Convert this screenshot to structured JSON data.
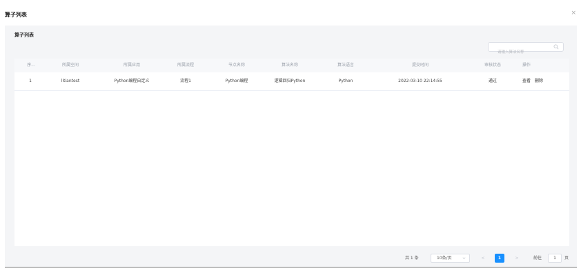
{
  "dialog": {
    "title": "算子列表",
    "close_glyph": "×"
  },
  "panel": {
    "title": "算子列表"
  },
  "search": {
    "placeholder": "请输入算法名称",
    "value": ""
  },
  "table": {
    "columns": [
      "序...",
      "所属空间",
      "所属应用",
      "所属流程",
      "节点名称",
      "算法名称",
      "算法语言",
      "提交时间",
      "审核状态",
      "操作"
    ],
    "rows": [
      {
        "index": "1",
        "space": "litiantest",
        "app": "Python编程自定义",
        "flow": "流程1",
        "node": "Python编程",
        "algo": "逻辑回归Python",
        "lang": "Python",
        "time": "2022-03-10 22:14:55",
        "status": "通过",
        "actions": [
          "查看",
          "删除"
        ]
      }
    ]
  },
  "pagination": {
    "total": "共 1 条",
    "page_size": "10条/页",
    "prev": "<",
    "current": "1",
    "next": ">",
    "goto_label": "前往",
    "goto_value": "1",
    "page_suffix": "页"
  },
  "colors": {
    "accent": "#1890ff",
    "panel_bg": "#f4f5f7",
    "header_bg": "#f7f8fa"
  },
  "icons": {
    "search": "search-icon",
    "close": "close-icon",
    "chevron": "chevron-down-icon"
  }
}
